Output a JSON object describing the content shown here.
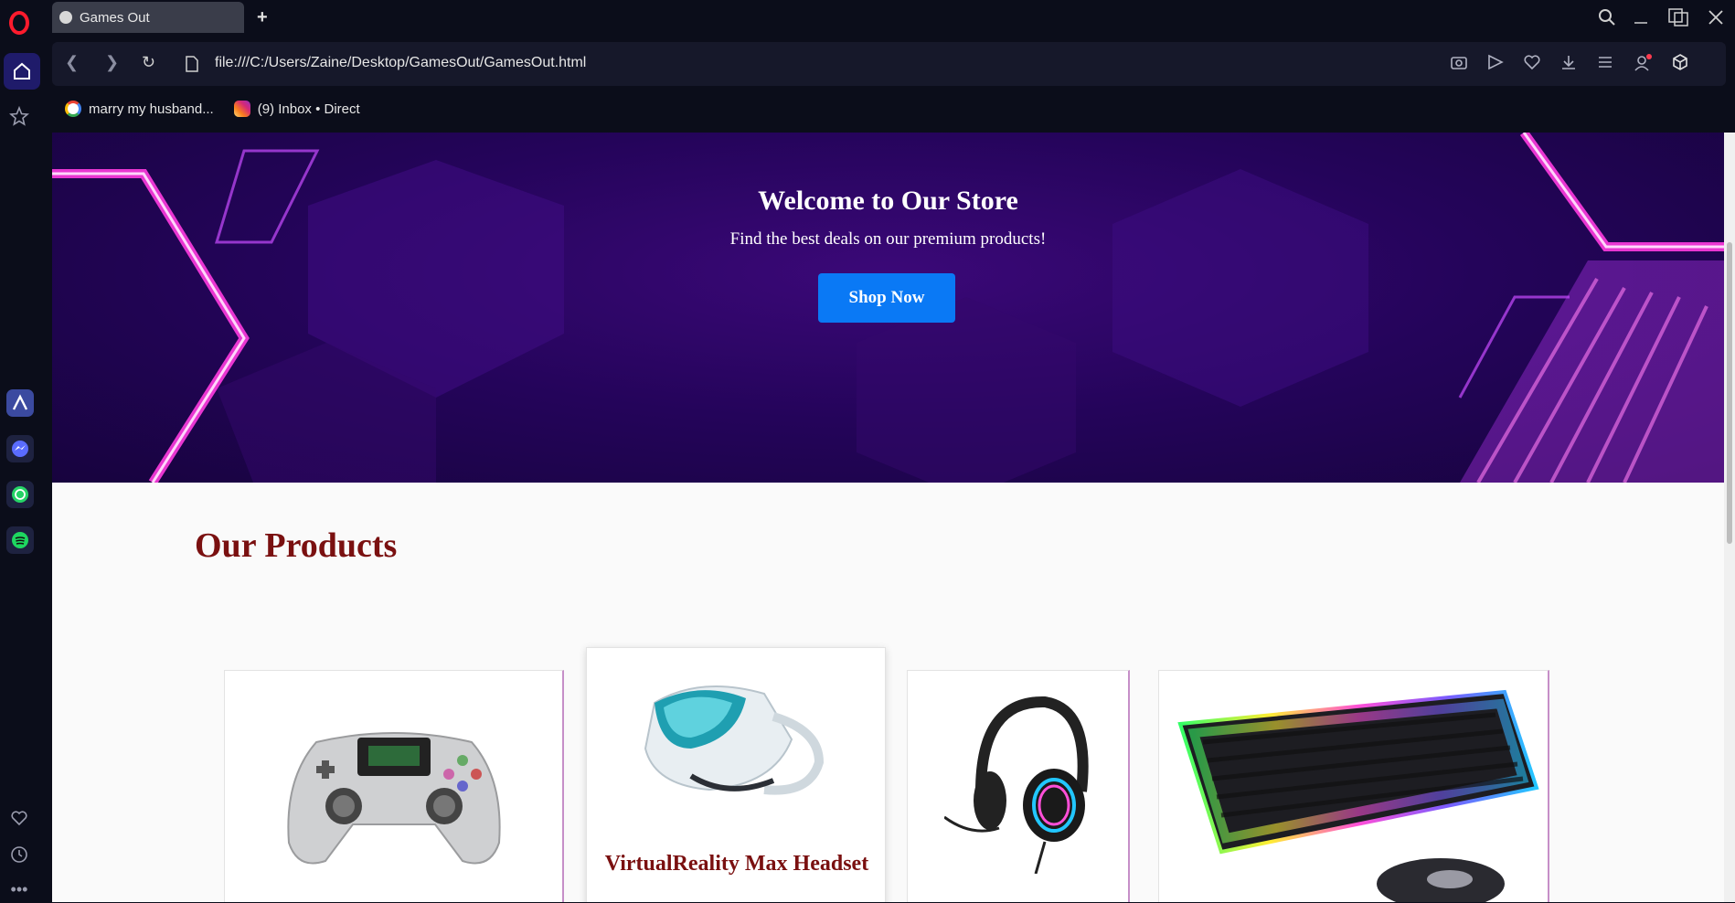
{
  "browser": {
    "tab_title": "Games Out",
    "url": "file:///C:/Users/Zaine/Desktop/GamesOut/GamesOut.html",
    "bookmarks": [
      {
        "label": "marry my husband...",
        "icon": "google-icon"
      },
      {
        "label": "(9) Inbox • Direct",
        "icon": "instagram-icon"
      }
    ],
    "sidebar_apps": [
      "aria-icon",
      "messenger-icon",
      "whatsapp-icon",
      "spotify-icon"
    ],
    "accent_color": "#1f1b6a"
  },
  "page": {
    "hero": {
      "title": "Welcome to Our Store",
      "subtitle": "Find the best deals on our premium products!",
      "button": "Shop Now",
      "button_color": "#0a79f5"
    },
    "products_heading": "Our Products",
    "products": [
      {
        "name": "",
        "image": "game-controller"
      },
      {
        "name": "VirtualReality Max Headset",
        "image": "vr-headset"
      },
      {
        "name": "",
        "image": "gaming-headset"
      },
      {
        "name": "",
        "image": "rgb-keyboard"
      }
    ]
  }
}
